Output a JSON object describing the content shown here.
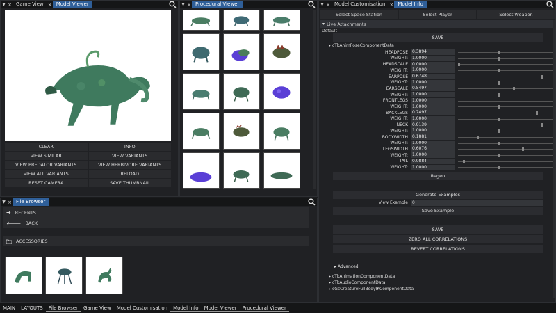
{
  "game_view": {
    "tabs": [
      "Game View",
      "Model Viewer"
    ],
    "buttons": [
      "CLEAR",
      "INFO",
      "VIEW SIMILAR",
      "VIEW VARIANTS",
      "VIEW PREDATOR VARIANTS",
      "VIEW HERBIVORE VARIANTS",
      "VIEW ALL VARIANTS",
      "RELOAD",
      "RESET CAMERA",
      "SAVE THUMBNAIL"
    ]
  },
  "procedural_viewer": {
    "tabs": [
      "Procedural Viewer"
    ]
  },
  "file_browser": {
    "tabs": [
      "File Browser"
    ],
    "recents": "RECENTS",
    "back": "BACK",
    "folder": "ACCESSORIES"
  },
  "customisation": {
    "tabs": [
      "Model Customisation",
      "Model Info"
    ],
    "top_buttons": [
      "Select Space Station",
      "Select Player",
      "Select Weapon"
    ],
    "section": "Live Attachments",
    "default": "Default",
    "save": "SAVE",
    "component": "cTkAnimPoseComponentData",
    "params": [
      {
        "label": "HEADPOSE",
        "value": "0.3894",
        "pos": 0.42
      },
      {
        "label": "WEIGHT:",
        "value": "1.0000",
        "pos": 0.42
      },
      {
        "label": "HEADSCALE",
        "value": "0.0000",
        "pos": 0.0
      },
      {
        "label": "WEIGHT:",
        "value": "1.0000",
        "pos": 0.42
      },
      {
        "label": "EARPOSE",
        "value": "0.6748",
        "pos": 0.88
      },
      {
        "label": "WEIGHT:",
        "value": "1.0000",
        "pos": 0.42
      },
      {
        "label": "EARSCALE",
        "value": "0.5497",
        "pos": 0.58
      },
      {
        "label": "WEIGHT:",
        "value": "1.0000",
        "pos": 0.42
      },
      {
        "label": "FRONTLEGS",
        "value": "1.0000",
        "pos": 1.0
      },
      {
        "label": "WEIGHT:",
        "value": "1.0000",
        "pos": 0.42
      },
      {
        "label": "BACKLEGS",
        "value": "0.7497",
        "pos": 0.82
      },
      {
        "label": "WEIGHT:",
        "value": "1.0000",
        "pos": 0.42
      },
      {
        "label": "NECK",
        "value": "0.9139",
        "pos": 0.88
      },
      {
        "label": "WEIGHT:",
        "value": "1.0000",
        "pos": 0.42
      },
      {
        "label": "BODYWIDTH",
        "value": "0.1881",
        "pos": 0.2
      },
      {
        "label": "WEIGHT:",
        "value": "1.0000",
        "pos": 0.42
      },
      {
        "label": "LEGSWIDTH",
        "value": "0.6076",
        "pos": 0.68
      },
      {
        "label": "WEIGHT:",
        "value": "1.0000",
        "pos": 0.42
      },
      {
        "label": "TAIL",
        "value": "0.0884",
        "pos": 0.05
      },
      {
        "label": "WEIGHT:",
        "value": "1.0000",
        "pos": 0.42
      }
    ],
    "regen": "Regen",
    "generate_examples": "Generate Examples",
    "view_example_label": "View Example",
    "view_example_value": "0",
    "save_example": "Save Example",
    "save2": "SAVE",
    "zero_all": "ZERO ALL CORRELATIONS",
    "revert": "REVERT CORRELATIONS",
    "advanced": "Advanced",
    "components": [
      "cTkAnimationComponentData",
      "cTkAudioComponentData",
      "cGcCreatureFullBodyIKComponentData"
    ]
  },
  "bottom_bar": [
    "MAIN",
    "LAYOUTS",
    "File Browser",
    "Game View",
    "Model Customisation",
    "Model Info",
    "Model Viewer",
    "Procedural Viewer"
  ],
  "colors": {
    "accent": "#2f5f99",
    "creature_green": "#4f8a6c",
    "creature_purple": "#5a3fd6"
  }
}
